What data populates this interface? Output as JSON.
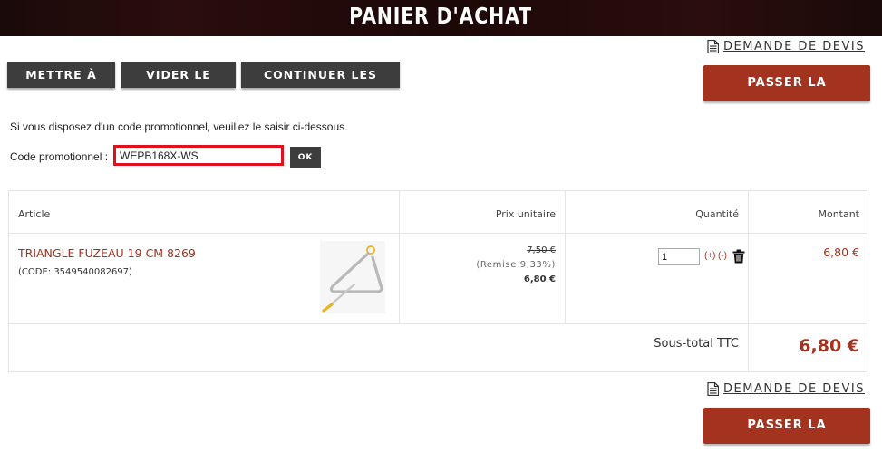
{
  "header": {
    "title": "PANIER D'ACHAT"
  },
  "links": {
    "quote_request": "DEMANDE DE DEVIS"
  },
  "buttons": {
    "update": "METTRE À JOUR",
    "clear_cart": "VIDER LE PANIER",
    "continue_shopping": "CONTINUER LES ACHATS",
    "checkout": "PASSER LA COMMANDE"
  },
  "promo": {
    "info": "Si vous disposez d'un code promotionnel, veuillez le saisir ci-dessous.",
    "label": "Code promotionnel :",
    "value": "WEPB168X-WS",
    "ok": "OK"
  },
  "table": {
    "headers": {
      "article": "Article",
      "unit_price": "Prix unitaire",
      "quantity": "Quantité",
      "amount": "Montant"
    },
    "items": [
      {
        "name": "TRIANGLE FUZEAU 19 CM 8269",
        "code": "(CODE: 3549540082697)",
        "old_price": "7,50 €",
        "discount": "(Remise 9,33%)",
        "unit_price": "6,80 €",
        "quantity": "1",
        "plus": "(+)",
        "minus": "(-)",
        "amount": "6,80 €"
      }
    ],
    "subtotal_label": "Sous-total TTC",
    "subtotal_value": "6,80 €"
  },
  "icons": {
    "document": "document-icon",
    "trash": "trash-icon"
  },
  "colors": {
    "accent": "#a3321f",
    "dark_button": "#3d3d3d",
    "promo_border": "#e0101c"
  }
}
